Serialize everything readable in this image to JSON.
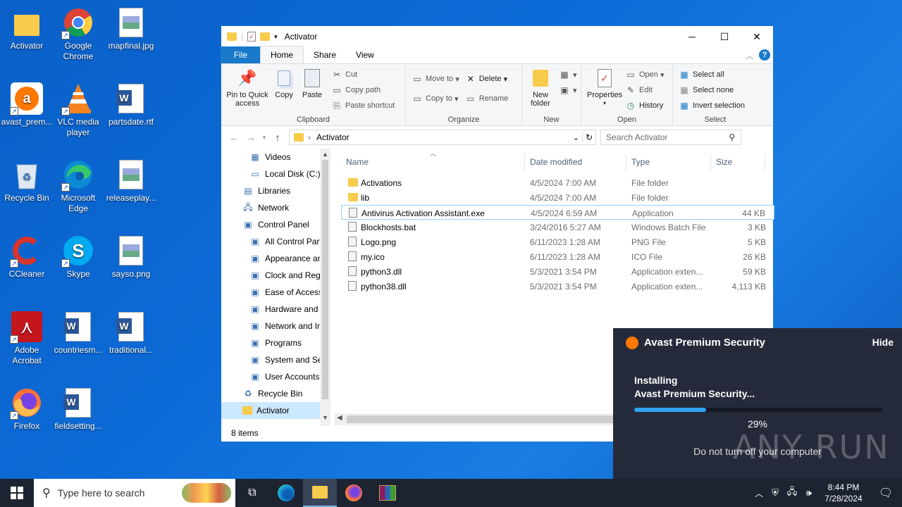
{
  "desktop": {
    "icons": [
      {
        "label": "Activator",
        "icon": "folder-icon"
      },
      {
        "label": "Google Chrome",
        "icon": "chrome-icon"
      },
      {
        "label": "mapfinal.jpg",
        "icon": "image-file-icon"
      },
      {
        "label": "avast_prem...",
        "icon": "avast-icon"
      },
      {
        "label": "VLC media player",
        "icon": "vlc-icon"
      },
      {
        "label": "partsdate.rtf",
        "icon": "word-doc-icon"
      },
      {
        "label": "Recycle Bin",
        "icon": "recycle-bin-icon"
      },
      {
        "label": "Microsoft Edge",
        "icon": "edge-icon"
      },
      {
        "label": "releaseplay...",
        "icon": "image-file-icon"
      },
      {
        "label": "CCleaner",
        "icon": "ccleaner-icon"
      },
      {
        "label": "Skype",
        "icon": "skype-icon"
      },
      {
        "label": "sayso.png",
        "icon": "image-file-icon"
      },
      {
        "label": "Adobe Acrobat",
        "icon": "acrobat-icon"
      },
      {
        "label": "countriesm...",
        "icon": "word-doc-icon"
      },
      {
        "label": "traditional...",
        "icon": "word-doc-icon"
      },
      {
        "label": "Firefox",
        "icon": "firefox-icon"
      },
      {
        "label": "fieldsetting...",
        "icon": "word-doc-icon"
      }
    ]
  },
  "explorer": {
    "title": "Activator",
    "window_controls": {
      "minimize": "─",
      "maximize": "☐",
      "close": "✕"
    },
    "ribbon_tabs": [
      "File",
      "Home",
      "Share",
      "View"
    ],
    "clipboard": {
      "pin": "Pin to Quick access",
      "copy": "Copy",
      "paste": "Paste",
      "cut": "Cut",
      "copy_path": "Copy path",
      "paste_shortcut": "Paste shortcut",
      "group": "Clipboard"
    },
    "organize": {
      "move_to": "Move to",
      "copy_to": "Copy to",
      "delete": "Delete",
      "rename": "Rename",
      "group": "Organize"
    },
    "new": {
      "new_folder": "New folder",
      "group": "New"
    },
    "open": {
      "properties": "Properties",
      "open": "Open",
      "edit": "Edit",
      "history": "History",
      "group": "Open"
    },
    "select": {
      "select_all": "Select all",
      "select_none": "Select none",
      "invert": "Invert selection",
      "group": "Select"
    },
    "address": "Activator",
    "search_placeholder": "Search Activator",
    "nav_items": [
      {
        "label": "Videos",
        "indent": 2
      },
      {
        "label": "Local Disk (C:)",
        "indent": 2
      },
      {
        "label": "Libraries",
        "indent": 1
      },
      {
        "label": "Network",
        "indent": 1
      },
      {
        "label": "Control Panel",
        "indent": 1
      },
      {
        "label": "All Control Pan",
        "indent": 2
      },
      {
        "label": "Appearance an",
        "indent": 2
      },
      {
        "label": "Clock and Regi",
        "indent": 2
      },
      {
        "label": "Ease of Access",
        "indent": 2
      },
      {
        "label": "Hardware and",
        "indent": 2
      },
      {
        "label": "Network and In",
        "indent": 2
      },
      {
        "label": "Programs",
        "indent": 2
      },
      {
        "label": "System and Sec",
        "indent": 2
      },
      {
        "label": "User Accounts",
        "indent": 2
      },
      {
        "label": "Recycle Bin",
        "indent": 1
      },
      {
        "label": "Activator",
        "indent": 1
      }
    ],
    "columns": [
      "Name",
      "Date modified",
      "Type",
      "Size"
    ],
    "files": [
      {
        "name": "Activations",
        "date": "4/5/2024 7:00 AM",
        "type": "File folder",
        "size": ""
      },
      {
        "name": "lib",
        "date": "4/5/2024 7:00 AM",
        "type": "File folder",
        "size": ""
      },
      {
        "name": "Antivirus Activation Assistant.exe",
        "date": "4/5/2024 6:59 AM",
        "type": "Application",
        "size": "44 KB"
      },
      {
        "name": "Blockhosts.bat",
        "date": "3/24/2016 5:27 AM",
        "type": "Windows Batch File",
        "size": "3 KB"
      },
      {
        "name": "Logo.png",
        "date": "6/11/2023 1:28 AM",
        "type": "PNG File",
        "size": "5 KB"
      },
      {
        "name": "my.ico",
        "date": "6/11/2023 1:28 AM",
        "type": "ICO File",
        "size": "26 KB"
      },
      {
        "name": "python3.dll",
        "date": "5/3/2021 3:54 PM",
        "type": "Application exten...",
        "size": "59 KB"
      },
      {
        "name": "python38.dll",
        "date": "5/3/2021 3:54 PM",
        "type": "Application exten...",
        "size": "4,113 KB"
      }
    ],
    "status": "8 items"
  },
  "avast_popup": {
    "title": "Avast Premium Security",
    "hide": "Hide",
    "installing": "Installing",
    "product": "Avast Premium Security...",
    "progress": 0.29,
    "percent": "29%",
    "warning": "Do not turn off your computer",
    "watermark": "ANY RUN"
  },
  "taskbar": {
    "search_placeholder": "Type here to search",
    "time": "8:44 PM",
    "date": "7/28/2024"
  },
  "colors": {
    "accent": "#1979ca",
    "folder": "#f8cb4b",
    "popup_bg": "#252a3a",
    "progress": "#2ea3f2"
  }
}
